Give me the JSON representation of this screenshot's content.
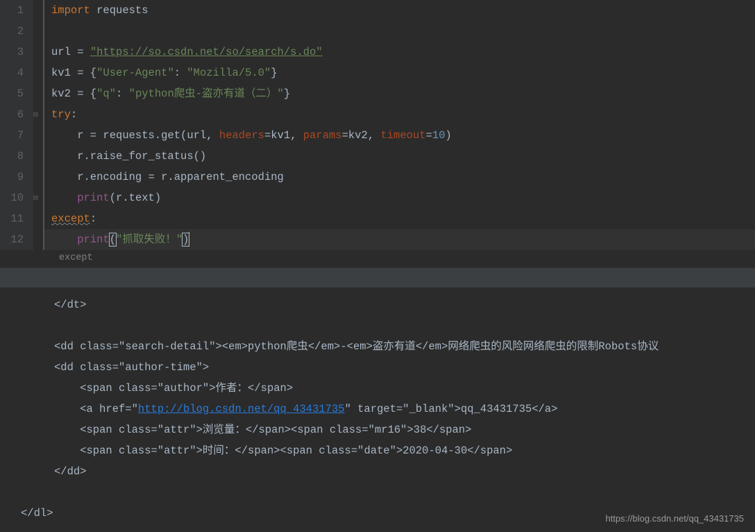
{
  "gutter": {
    "lines": [
      "1",
      "2",
      "3",
      "4",
      "5",
      "6",
      "7",
      "8",
      "9",
      "10",
      "11",
      "12"
    ]
  },
  "code": {
    "l1": {
      "a": "import",
      "b": " requests"
    },
    "l3": {
      "a": "url = ",
      "b": "\"https://so.csdn.net/so/search/s.do\""
    },
    "l4": {
      "a": "kv1 = {",
      "b": "\"User-Agent\"",
      "c": ": ",
      "d": "\"Mozilla/5.0\"",
      "e": "}"
    },
    "l5": {
      "a": "kv2 = {",
      "b": "\"q\"",
      "c": ": ",
      "d": "\"python爬虫-盗亦有道（二）\"",
      "e": "}"
    },
    "l6": {
      "a": "try",
      "b": ":"
    },
    "l7": {
      "a": "    r = requests.get(url",
      "b": ", ",
      "c": "headers",
      "d": "=kv1",
      "e": ", ",
      "f": "params",
      "g": "=kv2",
      "h": ", ",
      "i": "timeout",
      "j": "=",
      "k": "10",
      "l": ")"
    },
    "l8": {
      "a": "    r.raise_for_status()"
    },
    "l9": {
      "a": "    r.encoding = r.apparent_encoding"
    },
    "l10": {
      "a": "    ",
      "b": "print",
      "c": "(r.text)"
    },
    "l11": {
      "a": "except",
      "b": ":"
    },
    "l12": {
      "a": "    ",
      "b": "print",
      "c": "(",
      "d": "\"抓取失败！\"",
      "e": ")"
    }
  },
  "breadcrumb": {
    "text": "except"
  },
  "console": {
    "l1": "</dt>",
    "l3a": "<dd class=\"search-detail\"><em>python爬虫</em>-<em>盗亦有道</em>网络爬虫的风险网络爬虫的限制Robots协议",
    "l4": "<dd class=\"author-time\">",
    "l5": "    <span class=\"author\">作者：</span>",
    "l6a": "    <a href=\"",
    "l6link": "http://blog.csdn.net/qq_43431735",
    "l6b": "\" target=\"_blank\">qq_43431735</a>",
    "l7": "    <span class=\"attr\">浏览量：</span><span class=\"mr16\">38</span>",
    "l8": "    <span class=\"attr\">时间：</span><span class=\"date\">2020-04-30</span>",
    "l9": "</dd>",
    "l11": "</dl>"
  },
  "watermark": "https://blog.csdn.net/qq_43431735"
}
